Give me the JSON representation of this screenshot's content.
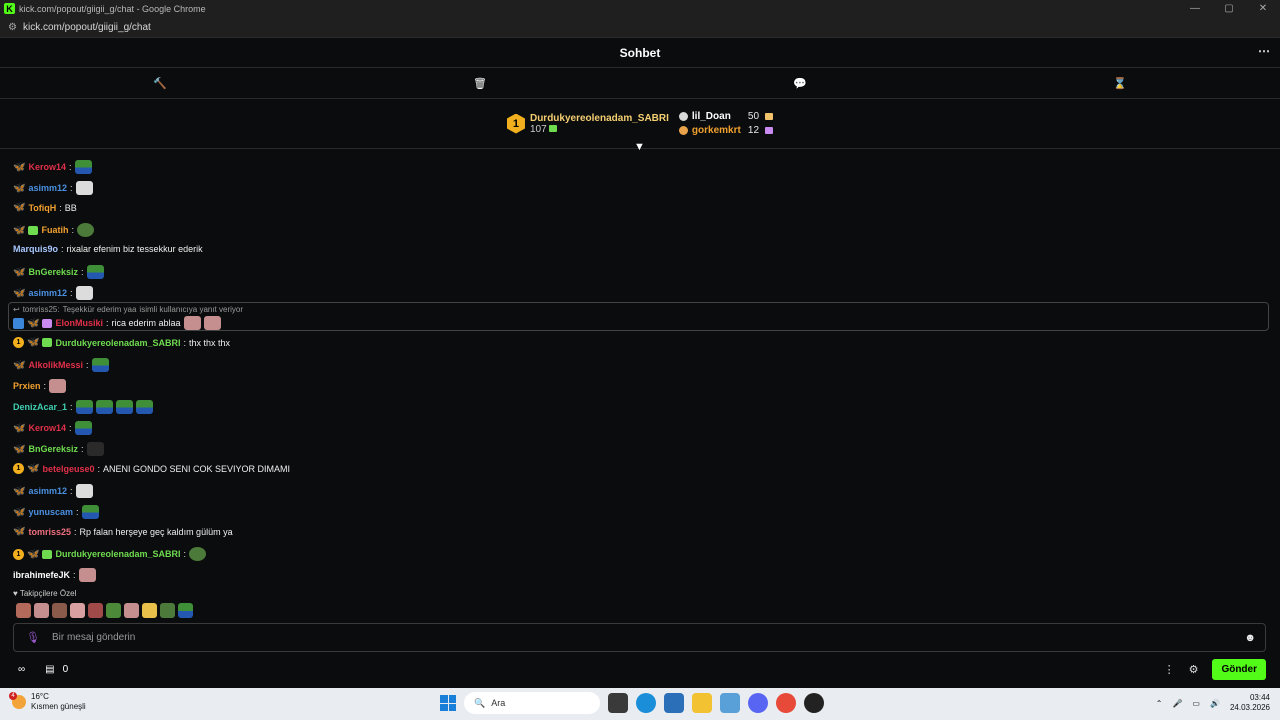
{
  "browser": {
    "title": "kick.com/popout/giigii_g/chat - Google Chrome",
    "url": "kick.com/popout/giigii_g/chat",
    "controls": [
      "—",
      "▢",
      "✕"
    ]
  },
  "chat": {
    "title": "Sohbet"
  },
  "leaderboard": {
    "first": {
      "rank": "1",
      "name": "Durdukyereolenadam_SABRI",
      "count": "107"
    },
    "second": {
      "name": "lil_Doan",
      "count": "50"
    },
    "third": {
      "name": "gorkemkrt",
      "count": "12"
    }
  },
  "reply": {
    "original_user": "tomriss25:",
    "original_text": "Teşekkür ederim yaa",
    "suffix": "isimli kullanıcıya yanıt veriyor"
  },
  "messages": [
    {
      "user": "Kerow14",
      "color": "#e0304a",
      "text": ""
    },
    {
      "user": "asimm12",
      "color": "#4a90e2",
      "text": ""
    },
    {
      "user": "TofiqH",
      "color": "#f0a030",
      "text": "BB"
    },
    {
      "user": "Fuatih",
      "color": "#f0a030",
      "text": ""
    },
    {
      "user": "Marquis9o",
      "color": "#a8c8ff",
      "text": "rixalar efenim biz tessekkur ederik"
    },
    {
      "user": "BnGereksiz",
      "color": "#6fdc50",
      "text": ""
    },
    {
      "user": "asimm12",
      "color": "#4a90e2",
      "text": ""
    },
    {
      "user": "ElonMusiki",
      "color": "#e0304a",
      "text": "rica ederim ablaa"
    },
    {
      "user": "Durdukyereolenadam_SABRI",
      "color": "#6fdc50",
      "text": "thx thx thx"
    },
    {
      "user": "AlkolikMessi",
      "color": "#e0304a",
      "text": ""
    },
    {
      "user": "Prxien",
      "color": "#f0a030",
      "text": ""
    },
    {
      "user": "DenizAcar_1",
      "color": "#3fd0b0",
      "text": ""
    },
    {
      "user": "Kerow14",
      "color": "#e0304a",
      "text": ""
    },
    {
      "user": "BnGereksiz",
      "color": "#6fdc50",
      "text": ""
    },
    {
      "user": "betelgeuse0",
      "color": "#e0304a",
      "text": "ANENI GONDO SENI COK SEVIYOR DIMAMI"
    },
    {
      "user": "asimm12",
      "color": "#4a90e2",
      "text": ""
    },
    {
      "user": "yunuscam",
      "color": "#4a90e2",
      "text": ""
    },
    {
      "user": "tomriss25",
      "color": "#f07080",
      "text": "Rp falan herşeye geç kaldım gülüm ya"
    },
    {
      "user": "Durdukyereolenadam_SABRI",
      "color": "#6fdc50",
      "text": ""
    },
    {
      "user": "ibrahimefeJK",
      "color": "#ffffff",
      "text": ""
    }
  ],
  "followers_only": "Takipçilere Özel",
  "input": {
    "placeholder": "Bir mesaj gönderin"
  },
  "bottom": {
    "points": "0",
    "send_label": "Gönder"
  },
  "taskbar": {
    "temp": "16°C",
    "weather": "Kısmen güneşli",
    "weather_badge": "4",
    "search": "Ara",
    "time": "03:44",
    "date": "24.03.2026"
  }
}
